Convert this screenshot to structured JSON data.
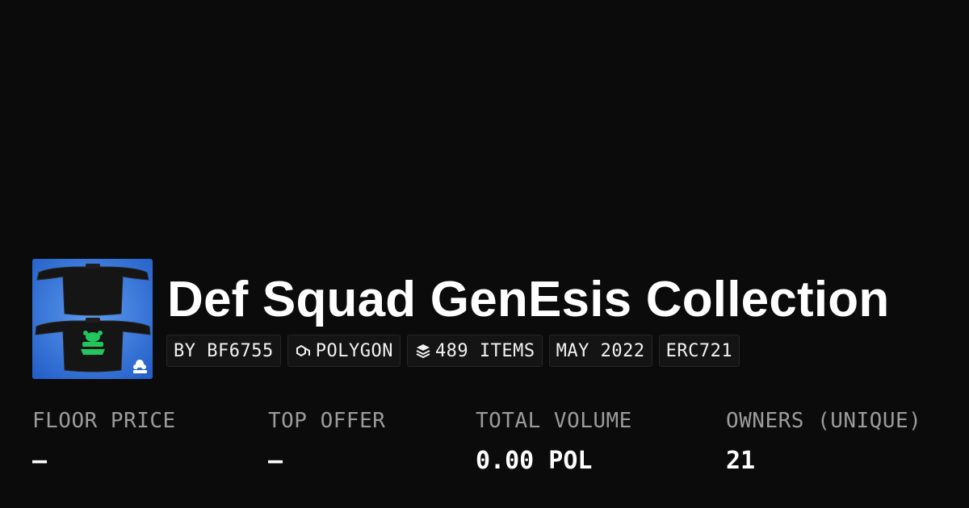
{
  "collection": {
    "title": "Def Squad GenEsis Collection",
    "image_alt": "black jacket with green logo"
  },
  "badges": [
    {
      "label": "BY BF6755",
      "icon": null
    },
    {
      "label": "POLYGON",
      "icon": "polygon-chain-icon"
    },
    {
      "label": "489 ITEMS",
      "icon": "layers-icon"
    },
    {
      "label": "MAY 2022",
      "icon": null
    },
    {
      "label": "ERC721",
      "icon": null
    }
  ],
  "stats": [
    {
      "label": "FLOOR PRICE",
      "value": "–"
    },
    {
      "label": "TOP OFFER",
      "value": "–"
    },
    {
      "label": "TOTAL VOLUME",
      "value": "0.00 POL"
    },
    {
      "label": "OWNERS (UNIQUE)",
      "value": "21"
    }
  ],
  "colors": {
    "background": "#0b0b0b",
    "badge_bg": "#141414",
    "label_gray": "#9b9b9b",
    "thumb_blue": "#2f6fd0",
    "logo_green": "#22c55e"
  }
}
